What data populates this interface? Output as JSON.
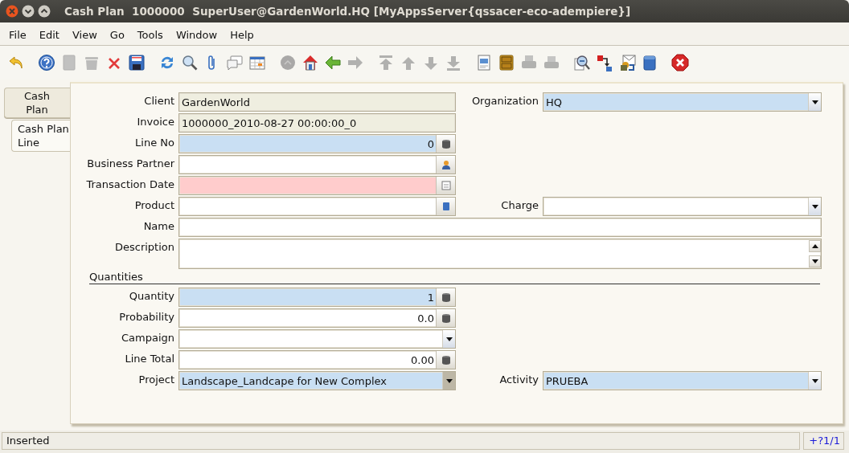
{
  "window": {
    "title": "Cash Plan  1000000  SuperUser@GardenWorld.HQ [MyAppsServer{qssacer-eco-adempiere}]"
  },
  "menu": [
    "File",
    "Edit",
    "View",
    "Go",
    "Tools",
    "Window",
    "Help"
  ],
  "toolbar": {
    "groups": [
      {
        "buttons": [
          {
            "kind": "undo",
            "disabled": false
          }
        ]
      },
      {
        "buttons": [
          {
            "kind": "help",
            "disabled": false
          },
          {
            "kind": "new",
            "disabled": true
          },
          {
            "kind": "delete",
            "disabled": true
          },
          {
            "kind": "delete_selection",
            "disabled": false
          },
          {
            "kind": "save",
            "disabled": false
          }
        ]
      },
      {
        "buttons": [
          {
            "kind": "refresh",
            "disabled": false
          },
          {
            "kind": "find",
            "disabled": false
          },
          {
            "kind": "attachment",
            "disabled": false
          },
          {
            "kind": "chat",
            "disabled": false
          },
          {
            "kind": "grid",
            "disabled": false
          }
        ]
      },
      {
        "buttons": [
          {
            "kind": "history",
            "disabled": true
          },
          {
            "kind": "home",
            "disabled": false
          },
          {
            "kind": "back",
            "disabled": false
          },
          {
            "kind": "forward",
            "disabled": true
          }
        ]
      },
      {
        "buttons": [
          {
            "kind": "first",
            "disabled": true
          },
          {
            "kind": "previous",
            "disabled": true
          },
          {
            "kind": "next",
            "disabled": true
          },
          {
            "kind": "last",
            "disabled": true
          }
        ]
      },
      {
        "buttons": [
          {
            "kind": "report",
            "disabled": false
          },
          {
            "kind": "archive",
            "disabled": false
          },
          {
            "kind": "print",
            "disabled": true
          },
          {
            "kind": "print_preview",
            "disabled": true
          }
        ]
      },
      {
        "buttons": [
          {
            "kind": "zoom_across",
            "disabled": false
          },
          {
            "kind": "workflow",
            "disabled": false
          },
          {
            "kind": "requests",
            "disabled": false
          },
          {
            "kind": "product_info",
            "disabled": false
          }
        ]
      },
      {
        "buttons": [
          {
            "kind": "exit",
            "disabled": false
          }
        ]
      }
    ]
  },
  "tabs": [
    {
      "label": "Cash Plan",
      "selected": false
    },
    {
      "label": "Cash Plan Line",
      "selected": true
    }
  ],
  "form": {
    "rows": [
      {
        "kind": "row",
        "fields": [
          {
            "label": "Client",
            "kind": "text",
            "value": "GardenWorld",
            "read_only": true
          },
          {
            "label": "Organization",
            "kind": "combo",
            "value": "HQ",
            "read_only": false,
            "mandatory": true,
            "focused": false
          }
        ]
      },
      {
        "kind": "row",
        "fields": [
          {
            "label": "Invoice",
            "kind": "text",
            "value": "1000000_2010-08-27 00:00:00_0",
            "read_only": true
          }
        ]
      },
      {
        "kind": "row",
        "fields": [
          {
            "label": "Line No",
            "kind": "number",
            "value": "0",
            "read_only": false,
            "mandatory": true
          }
        ]
      },
      {
        "kind": "row",
        "fields": [
          {
            "label": "Business Partner",
            "kind": "search_partner",
            "read_only": false,
            "mandatory": false
          }
        ]
      },
      {
        "kind": "row",
        "fields": [
          {
            "label": "Transaction Date",
            "kind": "date",
            "read_only": false,
            "mandatory": true
          }
        ]
      },
      {
        "kind": "row",
        "fields": [
          {
            "label": "Product",
            "kind": "search_product",
            "read_only": false,
            "mandatory": false
          },
          {
            "label": "Charge",
            "kind": "combo",
            "read_only": false,
            "mandatory": false,
            "focused": false
          }
        ]
      },
      {
        "kind": "wide_row",
        "fields": [
          {
            "label": "Name",
            "kind": "text",
            "read_only": false,
            "mandatory": false
          }
        ]
      },
      {
        "kind": "wide_row",
        "fields": [
          {
            "label": "Description",
            "kind": "textarea",
            "read_only": false,
            "mandatory": false
          }
        ]
      },
      {
        "kind": "section",
        "label": "Quantities"
      },
      {
        "kind": "row",
        "fields": [
          {
            "label": "Quantity",
            "kind": "number",
            "value": "1",
            "read_only": false,
            "mandatory": true
          }
        ]
      },
      {
        "kind": "row",
        "fields": [
          {
            "label": "Probability",
            "kind": "number",
            "value": "0.0",
            "read_only": false,
            "mandatory": false
          }
        ]
      },
      {
        "kind": "row",
        "fields": [
          {
            "label": "Campaign",
            "kind": "combo",
            "read_only": false,
            "mandatory": false,
            "focused": false
          }
        ]
      },
      {
        "kind": "row",
        "fields": [
          {
            "label": "Line Total",
            "kind": "number",
            "value": "0.00",
            "read_only": false,
            "mandatory": false
          }
        ]
      },
      {
        "kind": "row",
        "fields": [
          {
            "label": "Project",
            "kind": "combo",
            "value": "Landscape_Landcape for New Complex",
            "read_only": false,
            "mandatory": true,
            "focused": true
          },
          {
            "label": "Activity",
            "kind": "combo",
            "value": "PRUEBA",
            "read_only": false,
            "mandatory": true,
            "focused": false
          }
        ]
      }
    ]
  },
  "status_bar": {
    "message": "Inserted",
    "record": "+?1/1"
  }
}
